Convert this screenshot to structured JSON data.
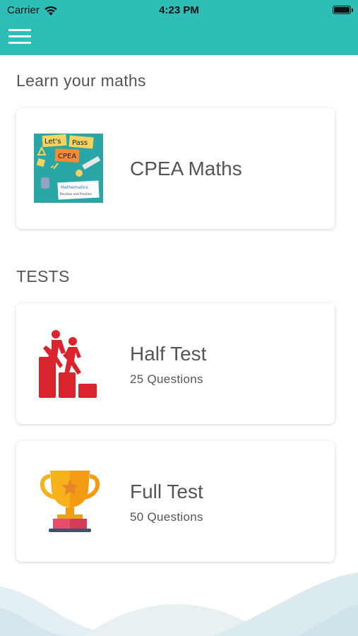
{
  "status_bar": {
    "carrier": "Carrier",
    "time": "4:23 PM",
    "icons": [
      "wifi-icon",
      "battery-icon"
    ]
  },
  "app_bar": {
    "icon": "hamburger-menu-icon",
    "color": "#2fbdb7"
  },
  "learn": {
    "heading": "Learn your maths",
    "card": {
      "title": "CPEA Maths",
      "thumbnail": {
        "line1": "Let's",
        "line2": "Pass",
        "line3": "CPEA",
        "line4": "Mathematics",
        "line5": "Revision and Practice"
      }
    }
  },
  "tests": {
    "heading": "TESTS",
    "items": [
      {
        "title": "Half Test",
        "subtitle": "25 Questions",
        "icon": "climbing-podium-icon"
      },
      {
        "title": "Full Test",
        "subtitle": "50 Questions",
        "icon": "trophy-icon"
      }
    ]
  },
  "colors": {
    "accent": "#2fbdb7",
    "text": "#555555",
    "half_test_icon": "#d9232d",
    "trophy_gold": "#f6b21b"
  }
}
